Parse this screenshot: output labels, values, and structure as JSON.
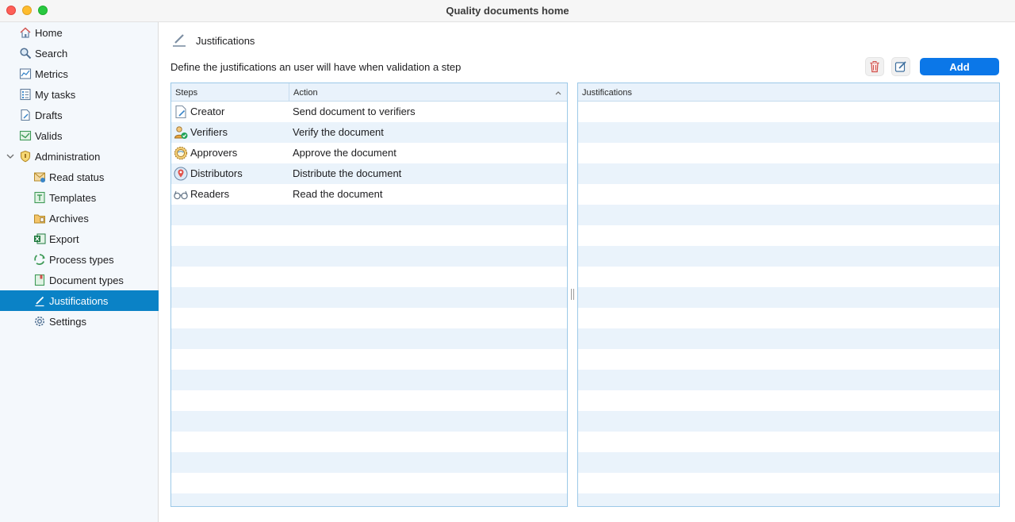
{
  "window": {
    "title": "Quality documents home"
  },
  "sidebar": {
    "items": [
      {
        "label": "Home",
        "icon": "home-icon"
      },
      {
        "label": "Search",
        "icon": "search-icon"
      },
      {
        "label": "Metrics",
        "icon": "metrics-icon"
      },
      {
        "label": "My tasks",
        "icon": "tasks-icon"
      },
      {
        "label": "Drafts",
        "icon": "drafts-icon"
      },
      {
        "label": "Valids",
        "icon": "valids-icon"
      },
      {
        "label": "Administration",
        "icon": "shield-icon",
        "expanded": true
      },
      {
        "label": "Read status",
        "icon": "read-status-icon"
      },
      {
        "label": "Templates",
        "icon": "templates-icon"
      },
      {
        "label": "Archives",
        "icon": "archives-icon"
      },
      {
        "label": "Export",
        "icon": "excel-icon"
      },
      {
        "label": "Process types",
        "icon": "recycle-icon"
      },
      {
        "label": "Document types",
        "icon": "document-types-icon"
      },
      {
        "label": "Justifications",
        "icon": "pen-icon",
        "selected": true
      },
      {
        "label": "Settings",
        "icon": "gear-icon"
      }
    ]
  },
  "main": {
    "title": "Justifications",
    "description": "Define the justifications an user will have when validation a step",
    "add_label": "Add",
    "steps_table": {
      "columns": [
        "Steps",
        "Action"
      ],
      "rows": [
        {
          "step": "Creator",
          "action": "Send document to verifiers",
          "icon": "creator-icon"
        },
        {
          "step": "Verifiers",
          "action": "Verify the document",
          "icon": "verifier-icon"
        },
        {
          "step": "Approvers",
          "action": "Approve the document",
          "icon": "approver-icon"
        },
        {
          "step": "Distributors",
          "action": "Distribute the document",
          "icon": "distributor-icon"
        },
        {
          "step": "Readers",
          "action": "Read the document",
          "icon": "glasses-icon"
        }
      ]
    },
    "justifications_table": {
      "columns": [
        "Justifications"
      ],
      "rows": []
    }
  },
  "colors": {
    "accent": "#0a82c6",
    "add_button": "#0b77e8",
    "row_alt": "#eaf3fb",
    "border": "#9cc9e8"
  }
}
